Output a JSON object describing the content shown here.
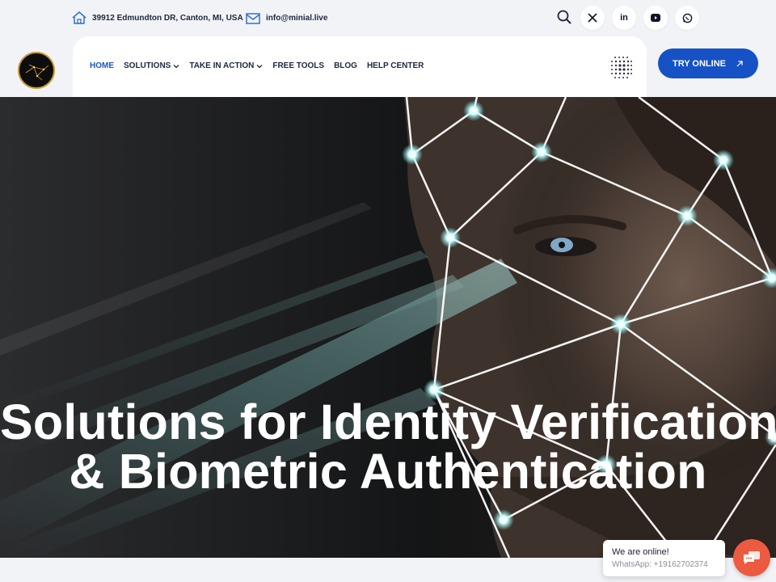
{
  "topbar": {
    "address": "39912 Edmundton DR, Canton, MI, USA",
    "email": "info@minial.live",
    "social": [
      "x-icon",
      "linkedin-icon",
      "youtube-icon",
      "whatsapp-icon"
    ]
  },
  "nav": {
    "items": [
      {
        "label": "HOME",
        "active": true,
        "dropdown": false
      },
      {
        "label": "SOLUTIONS",
        "active": false,
        "dropdown": true
      },
      {
        "label": "TAKE IN ACTION",
        "active": false,
        "dropdown": true
      },
      {
        "label": "FREE TOOLS",
        "active": false,
        "dropdown": false
      },
      {
        "label": "BLOG",
        "active": false,
        "dropdown": false
      },
      {
        "label": "HELP CENTER",
        "active": false,
        "dropdown": false
      }
    ],
    "cta_label": "TRY ONLINE"
  },
  "hero": {
    "title_line1": "Solutions for Identity Verification",
    "title_line2": "& Biometric Authentication"
  },
  "chat": {
    "title": "We are online!",
    "subtitle": "WhatsApp: +19162702374"
  },
  "colors": {
    "accent": "#1652c5",
    "active_nav": "#1a56c4",
    "text_dark": "#1d2740",
    "chat_button": "#ec5a3f",
    "page_bg": "#f2f3f6"
  }
}
